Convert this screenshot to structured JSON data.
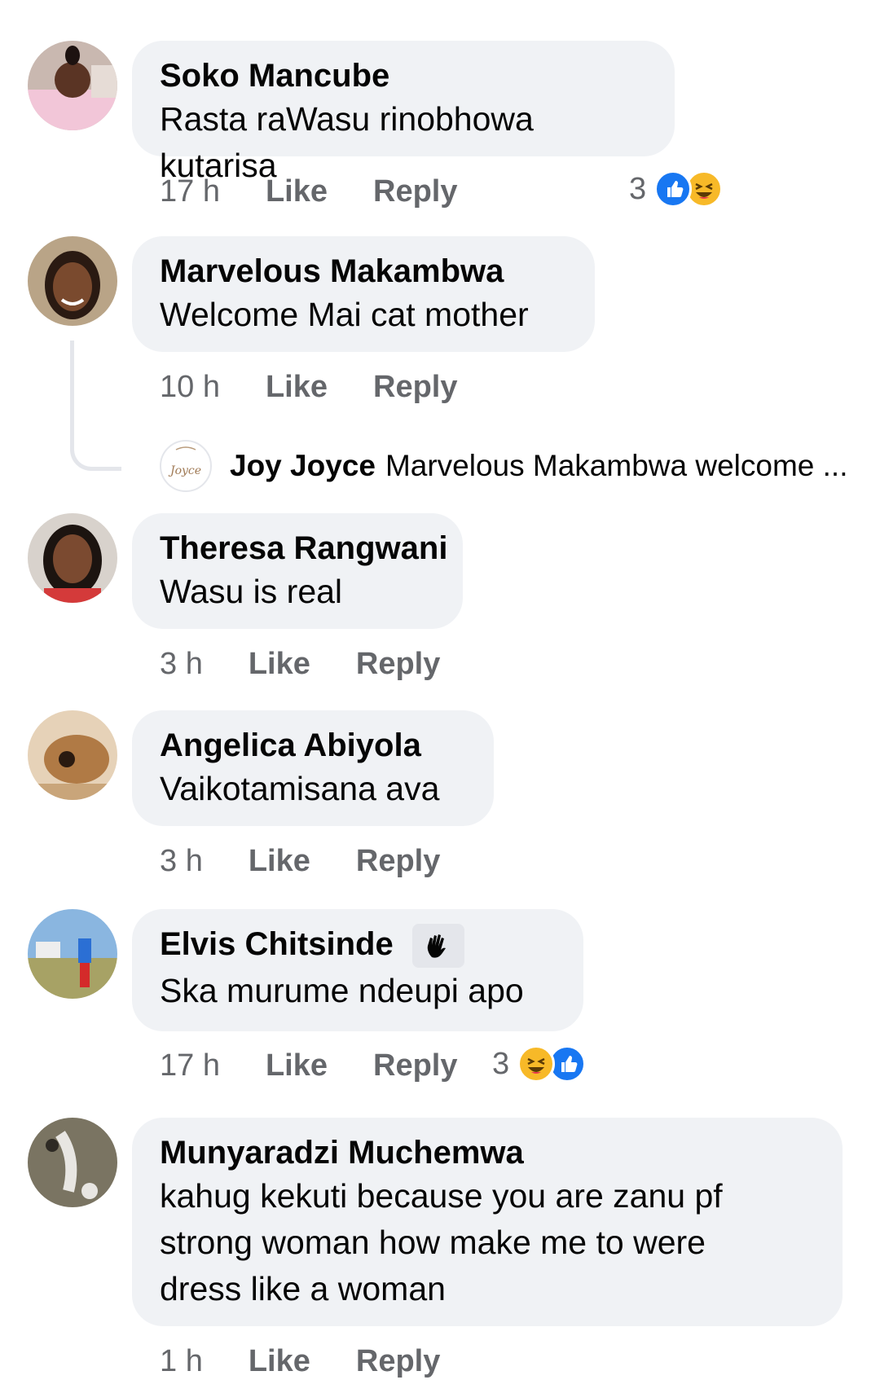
{
  "comments": [
    {
      "author": "Soko Mancube",
      "text": "Rasta raWasu rinobhowa kutarisa",
      "time": "17 h",
      "like": "Like",
      "reply": "Reply",
      "reaction_count": "3",
      "reactions": [
        "like",
        "haha"
      ]
    },
    {
      "author": "Marvelous Makambwa",
      "text": "Welcome Mai cat mother",
      "time": "10 h",
      "like": "Like",
      "reply": "Reply"
    },
    {
      "author": "Theresa Rangwani",
      "text": "Wasu is real",
      "time": "3 h",
      "like": "Like",
      "reply": "Reply"
    },
    {
      "author": "Angelica Abiyola",
      "text": "Vaikotamisana ava",
      "time": "3 h",
      "like": "Like",
      "reply": "Reply"
    },
    {
      "author": "Elvis Chitsinde",
      "text": "Ska murume ndeupi apo",
      "time": "17 h",
      "like": "Like",
      "reply": "Reply",
      "reaction_count": "3",
      "reactions": [
        "haha",
        "like"
      ],
      "badge_icon": "waving-hand-icon"
    },
    {
      "author": "Munyaradzi Muchemwa",
      "text_lines": [
        "kahug kekuti because you are zanu pf",
        "strong woman how make me to were",
        "dress like a woman"
      ],
      "time": "1 h",
      "like": "Like",
      "reply": "Reply"
    }
  ],
  "reply_preview": {
    "author": "Joy Joyce",
    "text": "Marvelous Makambwa welcome ...",
    "avatar_text": "Joyce"
  },
  "colors": {
    "bubble": "#f0f2f5",
    "meta": "#65676b",
    "like_blue": "#1877f2",
    "haha_yellow": "#f7b928"
  }
}
